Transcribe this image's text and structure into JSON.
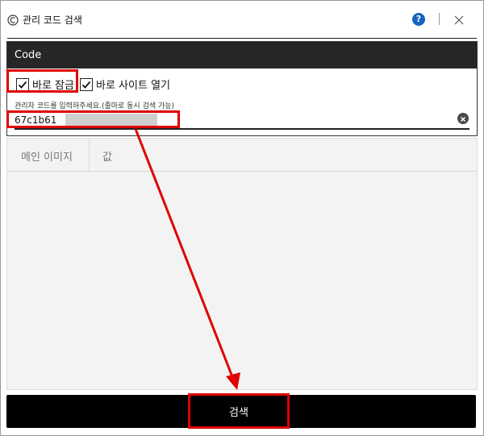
{
  "window": {
    "title": "관리 코드 검색"
  },
  "titlebar": {
    "help_label": "?"
  },
  "panel": {
    "header": "Code",
    "checkbox_lock": {
      "label": "바로 잠금",
      "checked": true
    },
    "checkbox_open_site": {
      "label": "바로 사이트 열기",
      "checked": true
    },
    "field_label": "관리자 코드를 입력하주세요.(줄마로 동시 검색 가능)",
    "code_value": "67c1b61"
  },
  "table": {
    "columns": [
      "메인 이미지",
      "값"
    ]
  },
  "actions": {
    "search_label": "검색"
  },
  "colors": {
    "header_bg": "#262626",
    "annotation": "#e00000",
    "help_icon": "#1565c0"
  }
}
